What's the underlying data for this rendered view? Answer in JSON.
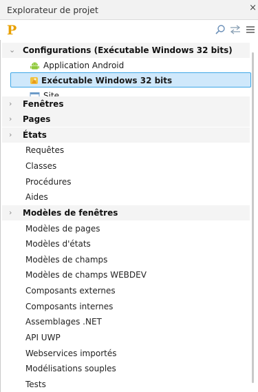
{
  "window": {
    "title": "Explorateur de projet",
    "close_glyph": "×"
  },
  "toolbar": {
    "logo_text": "P",
    "accent": "#e8a000"
  },
  "tree": {
    "configurations": {
      "label": "Configurations (Exécutable Windows 32 bits)",
      "expanded": true,
      "children": [
        {
          "label": "Application Android",
          "icon": "android-icon"
        },
        {
          "label": "Exécutable Windows 32 bits",
          "icon": "windows-executable-icon",
          "selected": true
        },
        {
          "label": "Site",
          "icon": "site-icon"
        }
      ]
    },
    "folders": [
      {
        "label": "Fenêtres"
      },
      {
        "label": "Pages"
      },
      {
        "label": "États"
      }
    ],
    "items_1": [
      "Requêtes",
      "Classes",
      "Procédures",
      "Aides"
    ],
    "modeles_fenetres": {
      "label": "Modèles de fenêtres"
    },
    "items_2": [
      "Modèles de pages",
      "Modèles d'états",
      "Modèles de champs",
      "Modèles de champs WEBDEV",
      "Composants externes",
      "Composants internes",
      "Assemblages .NET",
      "API UWP",
      "Webservices importés",
      "Modélisations souples",
      "Tests"
    ]
  },
  "colors": {
    "selection_bg": "#cfe8fb",
    "selection_border": "#3ea6e6",
    "android_green": "#8fc93a"
  }
}
